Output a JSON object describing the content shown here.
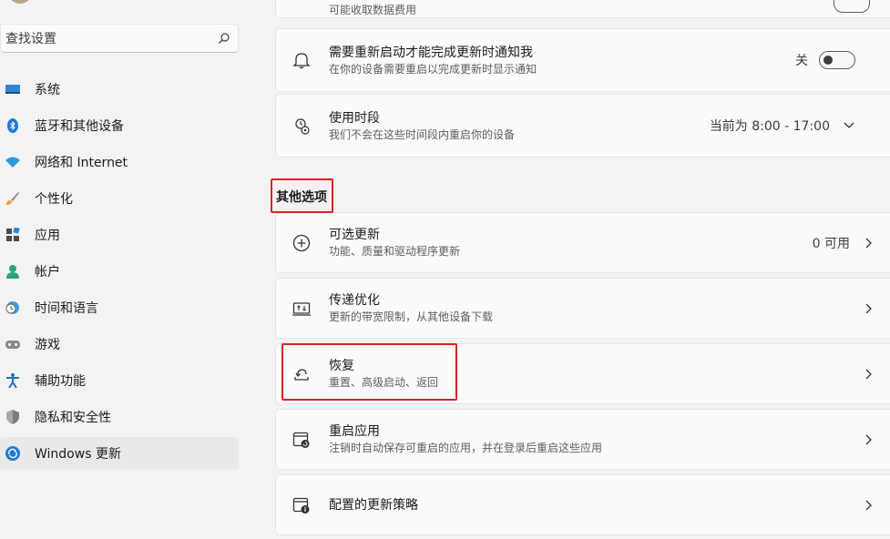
{
  "search": {
    "placeholder": "查找设置"
  },
  "sidebar": {
    "items": [
      {
        "label": "系统",
        "icon": "monitor-icon"
      },
      {
        "label": "蓝牙和其他设备",
        "icon": "bluetooth-icon"
      },
      {
        "label": "网络和 Internet",
        "icon": "wifi-icon"
      },
      {
        "label": "个性化",
        "icon": "brush-icon"
      },
      {
        "label": "应用",
        "icon": "apps-icon"
      },
      {
        "label": "帐户",
        "icon": "account-icon"
      },
      {
        "label": "时间和语言",
        "icon": "globe-clock-icon"
      },
      {
        "label": "游戏",
        "icon": "gamepad-icon"
      },
      {
        "label": "辅助功能",
        "icon": "accessibility-icon"
      },
      {
        "label": "隐私和安全性",
        "icon": "shield-icon"
      },
      {
        "label": "Windows 更新",
        "icon": "windows-update-icon",
        "selected": true
      }
    ]
  },
  "cards": {
    "top_partial": {
      "subtitle": "可能收取数据费用"
    },
    "notify": {
      "title": "需要重新启动才能完成更新时通知我",
      "subtitle": "在你的设备需要重启以完成更新时显示通知",
      "toggle_label": "关",
      "toggle_on": false
    },
    "active_hours": {
      "title": "使用时段",
      "subtitle": "我们不会在这些时间段内重启你的设备",
      "value": "当前为 8:00 - 17:00"
    }
  },
  "other_options": {
    "heading": "其他选项",
    "optional_updates": {
      "title": "可选更新",
      "subtitle": "功能、质量和驱动程序更新",
      "value": "0 可用"
    },
    "delivery_optimization": {
      "title": "传递优化",
      "subtitle": "更新的带宽限制，从其他设备下载"
    },
    "recovery": {
      "title": "恢复",
      "subtitle": "重置、高级启动、返回"
    },
    "restart_apps": {
      "title": "重启应用",
      "subtitle": "注销时自动保存可重启的应用，并在登录后重启这些应用"
    },
    "update_policies": {
      "title": "配置的更新策略"
    }
  },
  "colors": {
    "accent": "#0067c0",
    "highlight": "#e02020",
    "selected_bg": "#e9e9e9"
  }
}
